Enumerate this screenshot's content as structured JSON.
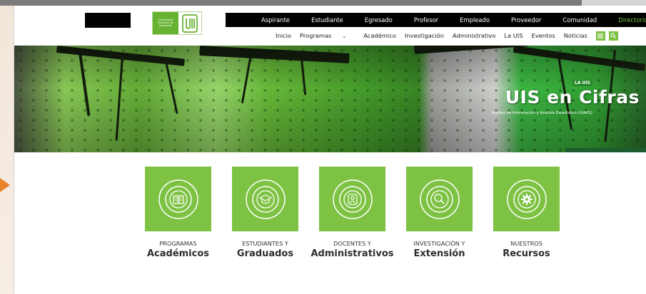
{
  "colors": {
    "accent_green": "#7dc242",
    "nav_black": "#000000",
    "text_dark": "#2d2d2d"
  },
  "logo": {
    "text": "Universidad Industrial de Santander"
  },
  "topnav": {
    "items": [
      "Aspirante",
      "Estudiante",
      "Egresado",
      "Profesor",
      "Empleado",
      "Proveedor",
      "Comunidad"
    ],
    "highlight": "Directorios"
  },
  "subnav": {
    "items": [
      "Inicio",
      "Programas",
      "Académico",
      "Investigación",
      "Administrativo",
      "La UIS",
      "Eventos",
      "Noticias"
    ]
  },
  "hero": {
    "badge": "LA UIS",
    "title": "UIS en Cifras",
    "subtitle": "Unidad de Información y Análisis Estadístico (UIAES)"
  },
  "cards": [
    {
      "small": "PROGRAMAS",
      "big": "Académicos",
      "icon": "book-icon"
    },
    {
      "small": "ESTUDIANTES Y",
      "big": "Graduados",
      "icon": "graduation-cap-icon"
    },
    {
      "small": "DOCENTES Y",
      "big": "Administrativos",
      "icon": "person-icon"
    },
    {
      "small": "INVESTIGACIÓN Y",
      "big": "Extensión",
      "icon": "magnifier-icon"
    },
    {
      "small": "NUESTROS",
      "big": "Recursos",
      "icon": "gear-icon"
    }
  ]
}
